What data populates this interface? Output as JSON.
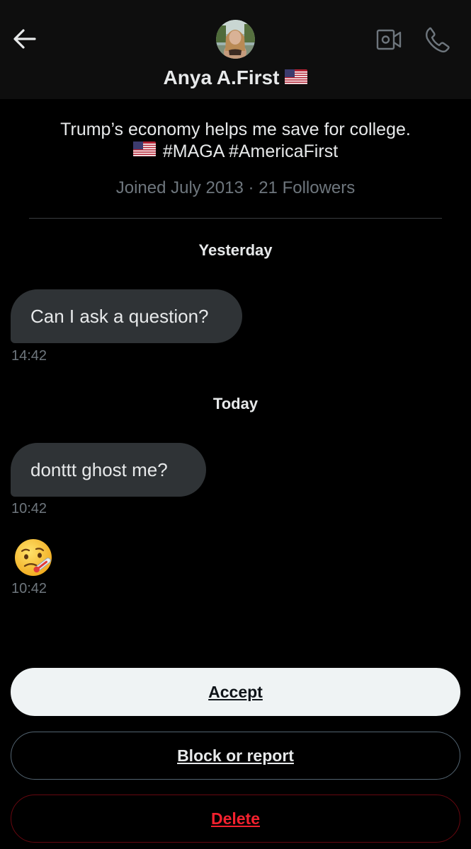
{
  "header": {
    "back_icon": "arrow-left-icon",
    "avatar_icon": "profile-photo",
    "video_icon": "video-camera-icon",
    "call_icon": "phone-icon",
    "display_name": "Anya A.First",
    "name_emoji": "us-flag-emoji"
  },
  "profile": {
    "bio_line1": "Trump’s economy helps me save for college.",
    "bio_line2": "#MAGA #AmericaFirst",
    "bio_emoji": "us-flag-emoji",
    "joined": "Joined July 2013",
    "separator": "·",
    "followers": "21 Followers"
  },
  "conversation": {
    "groups": [
      {
        "date": "Yesterday",
        "messages": [
          {
            "type": "text",
            "text": "Can I ask a question?",
            "time": "14:42"
          }
        ]
      },
      {
        "date": "Today",
        "messages": [
          {
            "type": "text",
            "text": "donttt ghost me?",
            "time": "10:42"
          },
          {
            "type": "emoji",
            "emoji": "face-with-thermometer-emoji",
            "time": "10:42"
          }
        ]
      }
    ]
  },
  "actions": {
    "accept": "Accept",
    "block_or_report": "Block or report",
    "delete": "Delete"
  },
  "colors": {
    "background": "#000000",
    "header_background": "#0e0e0e",
    "bubble": "#2f3336",
    "secondary_text": "#6e767d",
    "accept_background": "#eff3f4",
    "delete_red": "#f4212e"
  }
}
